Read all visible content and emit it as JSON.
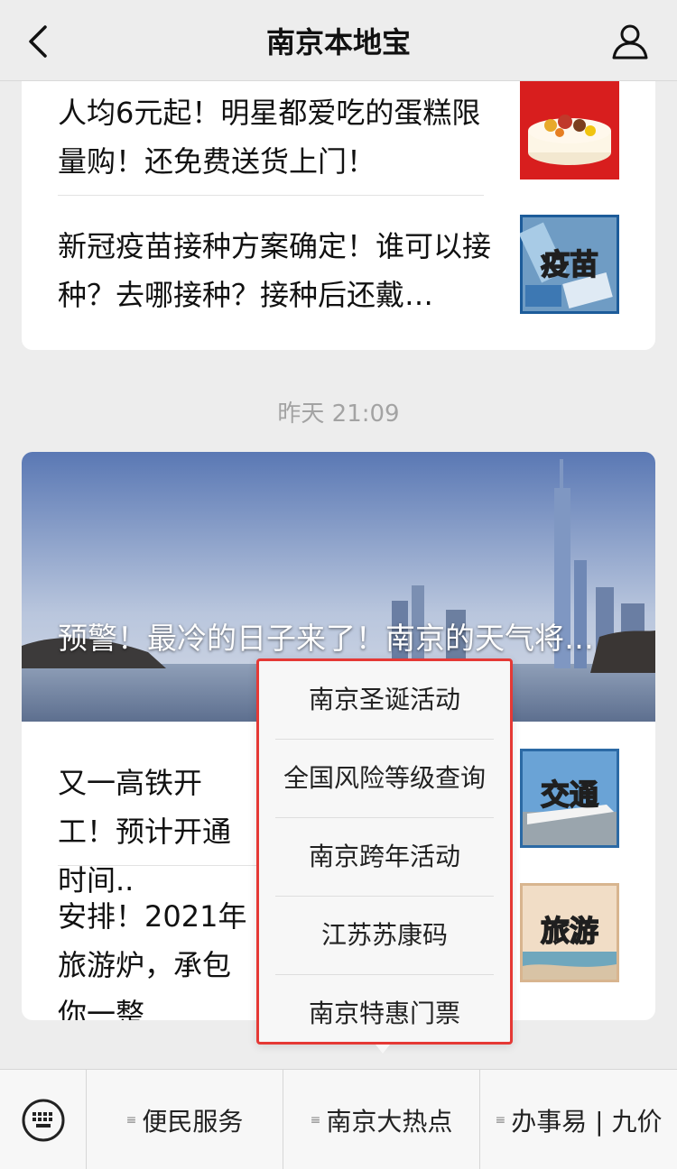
{
  "header": {
    "title": "南京本地宝"
  },
  "card1": {
    "items": [
      {
        "title": "人均6元起！明星都爱吃的蛋糕限量购！还免费送货上门！"
      },
      {
        "title": "新冠疫苗接种方案确定！谁可以接种？去哪接种？接种后还戴…",
        "thumb_label": "疫苗"
      }
    ]
  },
  "timestamp": "昨天 21:09",
  "card2": {
    "cover_title": "预警！最冷的日子来了！南京的天气将…",
    "items": [
      {
        "title": "又一高铁开工！预计开通时间..",
        "thumb_label": "交通"
      },
      {
        "title": "安排！2021年旅游炉，承包你一整",
        "thumb_label": "旅游"
      }
    ]
  },
  "popup": {
    "items": [
      "南京圣诞活动",
      "全国风险等级查询",
      "南京跨年活动",
      "江苏苏康码",
      "南京特惠门票"
    ]
  },
  "bottombar": {
    "tabs": [
      "便民服务",
      "南京大热点",
      "办事易 | 九价"
    ]
  },
  "colors": {
    "highlight": "#e53935",
    "bg": "#ededed"
  }
}
